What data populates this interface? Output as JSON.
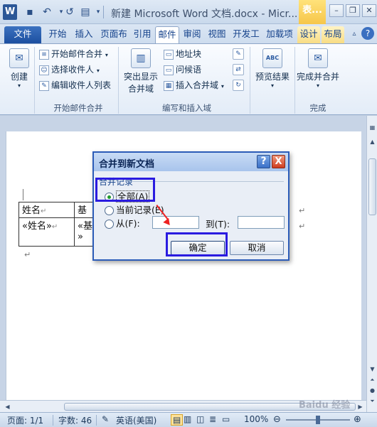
{
  "titlebar": {
    "word_logo": "W",
    "title": "新建 Microsoft Word 文档.docx - Micr...",
    "context_tab": "表..."
  },
  "ribbon_tabs": [
    {
      "label": "文件"
    },
    {
      "label": "开始"
    },
    {
      "label": "插入"
    },
    {
      "label": "页面布"
    },
    {
      "label": "引用"
    },
    {
      "label": "邮件"
    },
    {
      "label": "审阅"
    },
    {
      "label": "视图"
    },
    {
      "label": "开发工"
    },
    {
      "label": "加载项"
    },
    {
      "label": "设计"
    },
    {
      "label": "布局"
    }
  ],
  "ribbon": {
    "create": {
      "label": "创建"
    },
    "start_merge_group": {
      "label": "开始邮件合并",
      "start_merge": "开始邮件合并",
      "select_recipients": "选择收件人",
      "edit_recipients": "编辑收件人列表"
    },
    "write_insert_group": {
      "label": "编写和插入域",
      "highlight_fields_1": "突出显示",
      "highlight_fields_2": "合并域",
      "address_block": "地址块",
      "greeting_line": "问候语",
      "insert_merge_field": "插入合并域"
    },
    "preview": {
      "label": "预览结果",
      "icon_text": "ABC"
    },
    "finish_group": {
      "label": "完成",
      "finish_merge": "完成并合并"
    }
  },
  "document": {
    "table": {
      "row1": [
        "姓名",
        "基"
      ],
      "row2": [
        "«姓名»",
        "«基"
      ]
    },
    "row2_overflow": "»"
  },
  "dialog": {
    "title": "合并到新文档",
    "help": "?",
    "close": "X",
    "group_label": "合并记录",
    "option_all": "全部(A)",
    "option_current": "当前记录(E)",
    "option_from": "从(F):",
    "to_label": "到(T):",
    "from_value": "",
    "to_value": "",
    "ok": "确定",
    "cancel": "取消"
  },
  "statusbar": {
    "page": "页面: 1/1",
    "words": "字数: 46",
    "language": "英语(美国)",
    "zoom": "100%"
  },
  "watermark": "Baidu 经验"
}
